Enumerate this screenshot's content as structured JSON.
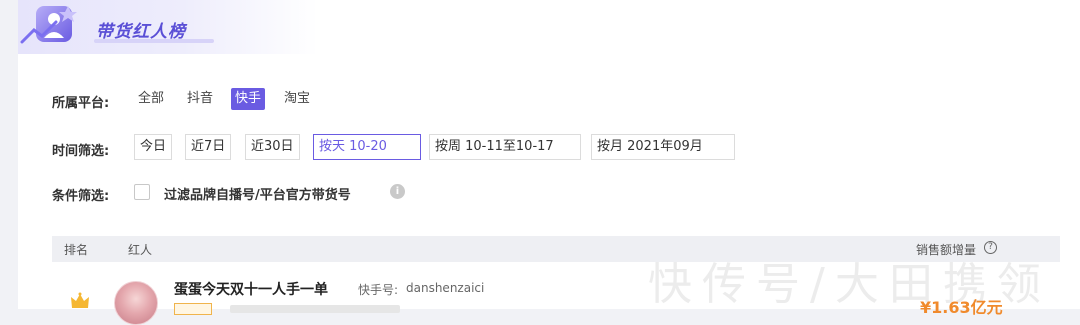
{
  "header": {
    "title": "带货红人榜"
  },
  "platform_filter": {
    "label": "所属平台:",
    "options": [
      "全部",
      "抖音",
      "快手",
      "淘宝"
    ],
    "selected": "快手"
  },
  "time_filter": {
    "label": "时间筛选:",
    "options": [
      "今日",
      "近7日",
      "近30日",
      "按天 10-20",
      "按周 10-11至10-17",
      "按月 2021年09月"
    ],
    "selected": "按天 10-20"
  },
  "condition_filter": {
    "label": "条件筛选:",
    "checkbox_label": "过滤品牌自播号/平台官方带货号",
    "checked": false
  },
  "table": {
    "columns": [
      "排名",
      "红人",
      "销售额增量"
    ],
    "rows": [
      {
        "rank_icon": "crown-icon",
        "name": "蛋蛋今天双十一人手一单",
        "platform_id_label": "快手号:",
        "platform_id": "danshenzaici",
        "sales": "¥1.63亿元"
      }
    ]
  },
  "watermark": "快传号/大田携领",
  "colors": {
    "accent": "#6a5be2",
    "sales": "#f08a2c"
  }
}
